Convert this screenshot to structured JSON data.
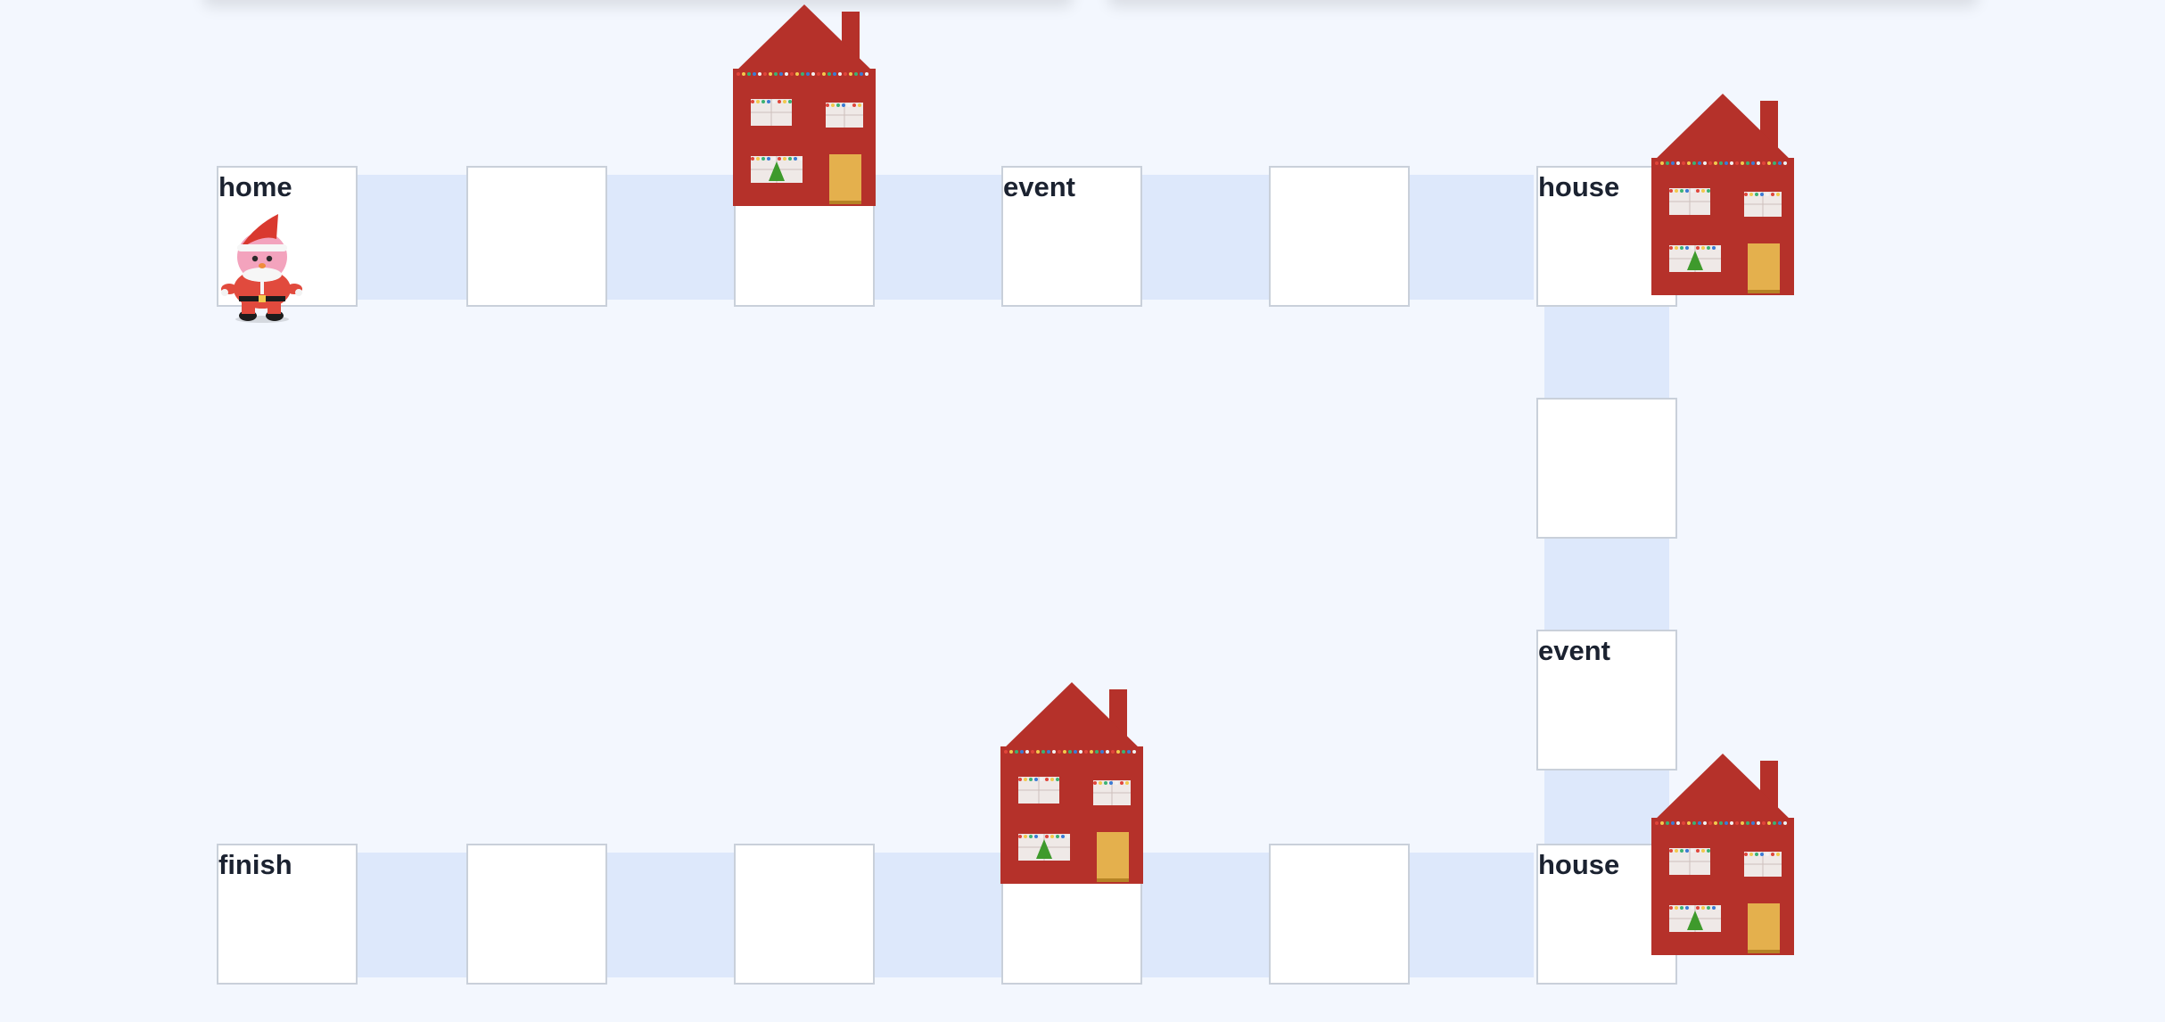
{
  "board": {
    "background": "#f3f7fe",
    "path_color": "#dde8fb",
    "tile_color": "#ffffff",
    "tiles": [
      {
        "id": "r1c1",
        "label": "home"
      },
      {
        "id": "r1c2",
        "label": ""
      },
      {
        "id": "r1c3",
        "label": ""
      },
      {
        "id": "r1c4",
        "label": "event"
      },
      {
        "id": "r1c5",
        "label": ""
      },
      {
        "id": "r1c6",
        "label": "house"
      },
      {
        "id": "r2c6",
        "label": ""
      },
      {
        "id": "r3c6",
        "label": "event"
      },
      {
        "id": "r4c1",
        "label": "finish"
      },
      {
        "id": "r4c2",
        "label": ""
      },
      {
        "id": "r4c3",
        "label": ""
      },
      {
        "id": "r4c4",
        "label": ""
      },
      {
        "id": "r4c5",
        "label": ""
      },
      {
        "id": "r4c6",
        "label": "house"
      }
    ]
  },
  "pieces": {
    "player": {
      "name": "santa",
      "on_tile": "home"
    },
    "houses": [
      {
        "name": "house-1",
        "on_tile": "r1c3"
      },
      {
        "name": "house-2",
        "on_tile": "r1c6"
      },
      {
        "name": "house-3",
        "on_tile": "r4c4"
      },
      {
        "name": "house-4",
        "on_tile": "r4c6"
      }
    ],
    "house_colors": {
      "wall": "#b5312a",
      "door": "#e4b04d",
      "window": "#efe9e7",
      "tree": "#3e9a2c"
    }
  }
}
